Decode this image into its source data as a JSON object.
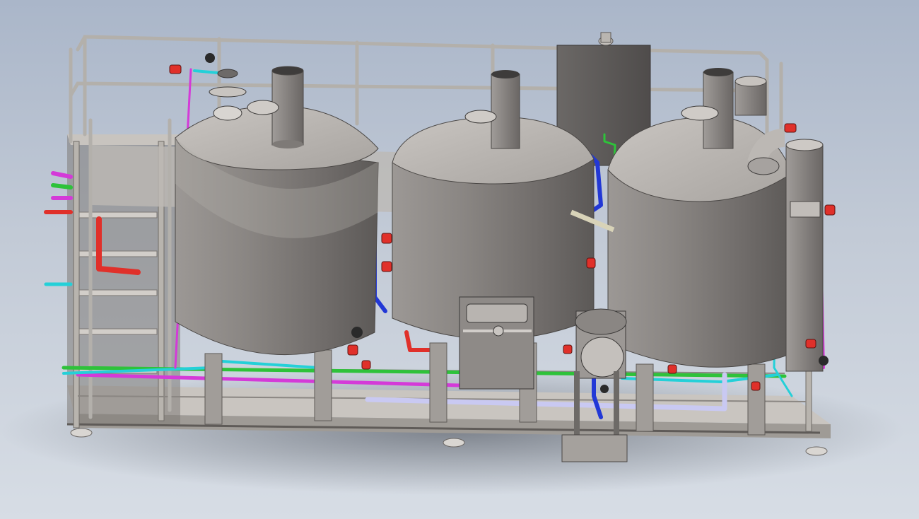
{
  "scene": {
    "kind": "3d-cad-render",
    "subject": "brewhouse-skid",
    "tanks": 3,
    "colors": {
      "background_top": "#aab6c9",
      "background_bottom": "#d7dde5",
      "steel": "#8d8a88",
      "frame": "#b7b3ad",
      "pipe_magenta": "#d43ad8",
      "pipe_green": "#2ec23a",
      "pipe_cyan": "#24d0d8",
      "pipe_blue": "#2238d6",
      "pipe_red": "#e0302a",
      "pipe_lavender": "#c9c9f2"
    },
    "icons": [
      "manway-icon",
      "valve-icon",
      "vent-stack-icon"
    ]
  }
}
